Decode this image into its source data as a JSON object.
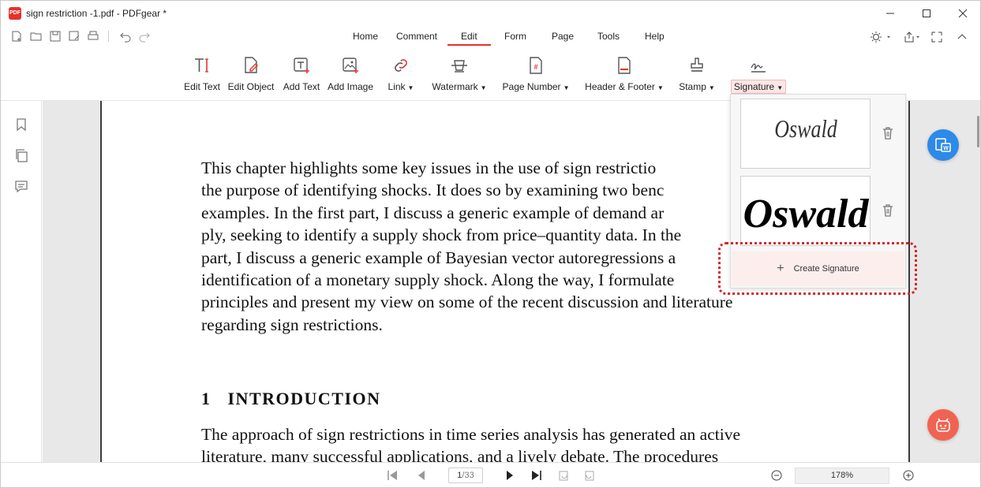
{
  "window": {
    "title": "sign restriction -1.pdf - PDFgear *",
    "logo_text": "PDF"
  },
  "menu": {
    "tabs": [
      "Home",
      "Comment",
      "Edit",
      "Form",
      "Page",
      "Tools",
      "Help"
    ],
    "active": "Edit"
  },
  "ribbon": {
    "tools": [
      {
        "label": "Edit Text",
        "icon": "edit-text-icon"
      },
      {
        "label": "Edit Object",
        "icon": "edit-object-icon"
      },
      {
        "label": "Add Text",
        "icon": "add-text-icon"
      },
      {
        "label": "Add Image",
        "icon": "add-image-icon"
      },
      {
        "label": "Link",
        "icon": "link-icon"
      },
      {
        "label": "Watermark",
        "icon": "watermark-icon"
      },
      {
        "label": "Page Number",
        "icon": "page-number-icon"
      },
      {
        "label": "Header & Footer",
        "icon": "header-footer-icon"
      },
      {
        "label": "Stamp",
        "icon": "stamp-icon"
      },
      {
        "label": "Signature",
        "icon": "signature-icon"
      }
    ]
  },
  "document": {
    "lines": [
      "This chapter highlights some key issues in the use of sign restrictio",
      "the purpose of identifying shocks. It does so by examining two benc",
      "examples. In the first part, I discuss a generic example of demand ar",
      "ply, seeking to identify a supply shock from price–quantity data. In the",
      "part, I discuss a generic example of Bayesian vector autoregressions a",
      "identification of a monetary supply shock. Along the way, I formulate",
      "principles and present my view on some of the recent discussion and literature",
      "regarding sign restrictions."
    ],
    "heading": "1   INTRODUCTION",
    "lines2": [
      "The approach of sign restrictions in time series analysis has generated an active",
      "literature, many successful applications, and a lively debate. The procedures"
    ]
  },
  "signature_panel": {
    "signatures": [
      "Oswald",
      "Oswald"
    ],
    "create_label": "Create Signature"
  },
  "pager": {
    "current": "1",
    "total": "/33",
    "zoom": "178%"
  },
  "colors": {
    "accent": "#e5322d",
    "word_button": "#2d8ae8",
    "bot_button": "#f06352"
  }
}
